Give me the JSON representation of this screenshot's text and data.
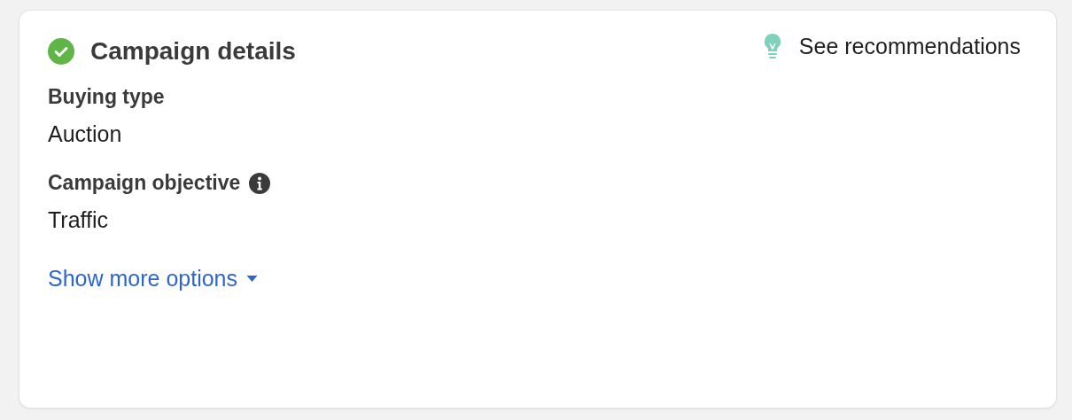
{
  "card": {
    "title": "Campaign details",
    "completed": true,
    "recommendations_link": "See recommendations",
    "fields": [
      {
        "label": "Buying type",
        "value": "Auction",
        "info": false
      },
      {
        "label": "Campaign objective",
        "value": "Traffic",
        "info": true
      }
    ],
    "more_options_link": "Show more options"
  }
}
